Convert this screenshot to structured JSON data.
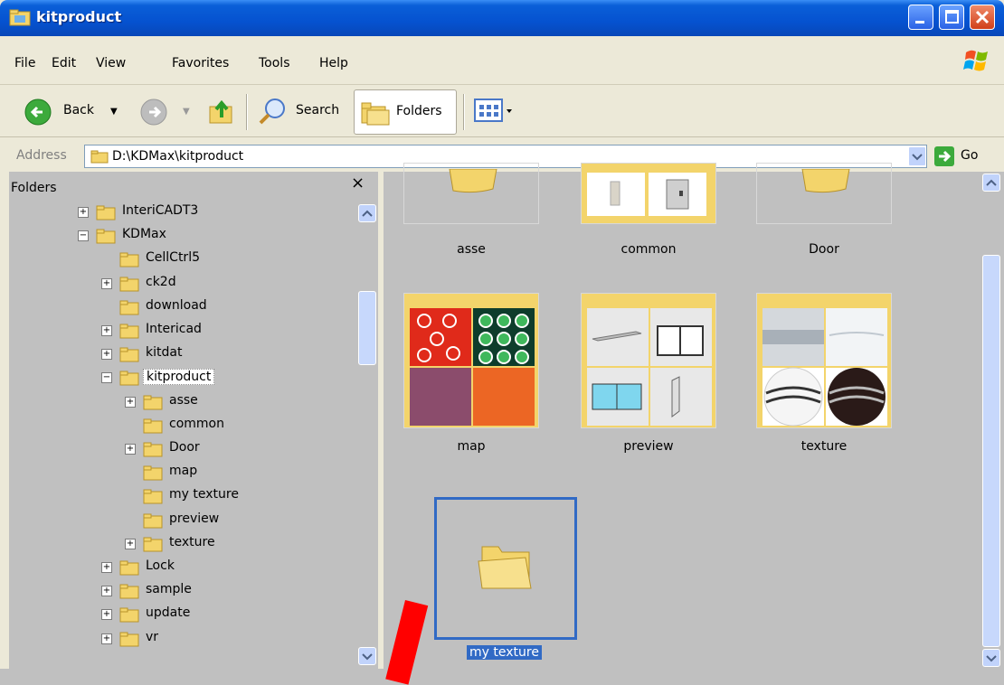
{
  "window": {
    "title": "kitproduct"
  },
  "menu": [
    "File",
    "Edit",
    "View",
    "Favorites",
    "Tools",
    "Help"
  ],
  "toolbar": {
    "back_label": "Back",
    "search_label": "Search",
    "folders_label": "Folders"
  },
  "address": {
    "label": "Address",
    "value": "D:\\KDMax\\kitproduct",
    "go_label": "Go"
  },
  "folders_pane": {
    "title": "Folders",
    "close_glyph": "×",
    "tree": [
      {
        "label": "InteriCADT3",
        "expander": "+"
      },
      {
        "label": "KDMax",
        "expander": "−"
      },
      {
        "label": "CellCtrl5",
        "expander": ""
      },
      {
        "label": "ck2d",
        "expander": "+"
      },
      {
        "label": "download",
        "expander": ""
      },
      {
        "label": "Intericad",
        "expander": "+"
      },
      {
        "label": "kitdat",
        "expander": "+"
      },
      {
        "label": "kitproduct",
        "expander": "−"
      },
      {
        "label": "asse",
        "expander": "+"
      },
      {
        "label": "common",
        "expander": ""
      },
      {
        "label": "Door",
        "expander": "+"
      },
      {
        "label": "map",
        "expander": ""
      },
      {
        "label": "my texture",
        "expander": ""
      },
      {
        "label": "preview",
        "expander": ""
      },
      {
        "label": "texture",
        "expander": "+"
      },
      {
        "label": "Lock",
        "expander": "+"
      },
      {
        "label": "sample",
        "expander": "+"
      },
      {
        "label": "update",
        "expander": "+"
      },
      {
        "label": "vr",
        "expander": "+"
      }
    ]
  },
  "content": {
    "items": [
      {
        "label": "asse"
      },
      {
        "label": "common"
      },
      {
        "label": "Door"
      },
      {
        "label": "map"
      },
      {
        "label": "preview"
      },
      {
        "label": "texture"
      },
      {
        "label": "my texture"
      }
    ]
  },
  "colors": {
    "titlebar": "#0552d0",
    "selection": "#316ac5",
    "annotation_arrow": "#ff0000"
  }
}
